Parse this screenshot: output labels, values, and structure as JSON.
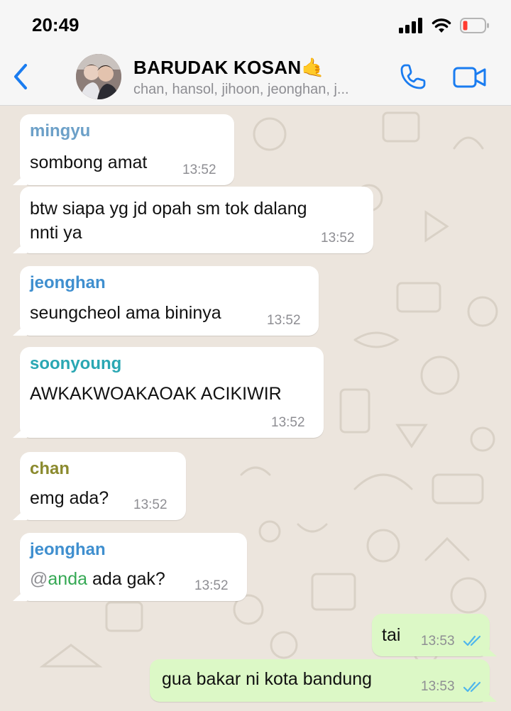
{
  "status_bar": {
    "time": "20:49"
  },
  "header": {
    "title": "BARUDAK KOSAN",
    "title_emoji": "🤙",
    "subtitle": "chan, hansol, jihoon, jeonghan, j...",
    "back_icon": "chevron-left-icon",
    "call_icon": "phone-icon",
    "video_icon": "video-camera-icon"
  },
  "colors": {
    "accent": "#1a7cf0",
    "incoming_bubble": "#ffffff",
    "outgoing_bubble": "#dcf8c6",
    "wallpaper": "#ece5dd",
    "read_ticks": "#4fb6ec"
  },
  "messages": [
    {
      "sender": "mingyu",
      "sender_color": "#6ca0c8",
      "text": "sombong amat",
      "time": "13:52"
    },
    {
      "sender": "",
      "sender_color": "",
      "text_line1": "btw siapa yg jd opah sm tok dalang",
      "text_line2": "nnti ya",
      "time": "13:52"
    },
    {
      "sender": "jeonghan",
      "sender_color": "#3f8fcf",
      "text": "seungcheol ama bininya",
      "time": "13:52"
    },
    {
      "sender": "soonyoung",
      "sender_color": "#2aa7b3",
      "text": "AWKAKWOAKAOAK ACIKIWIR",
      "time": "13:52"
    },
    {
      "sender": "chan",
      "sender_color": "#8b8a2e",
      "text": "emg ada?",
      "time": "13:52"
    },
    {
      "sender": "jeonghan",
      "sender_color": "#3f8fcf",
      "mention_at": "@",
      "mention_name": "anda",
      "text_after": " ada gak?",
      "time": "13:52"
    },
    {
      "text": "tai",
      "time": "13:53",
      "status": "read"
    },
    {
      "text": "gua bakar ni kota bandung",
      "time": "13:53",
      "status": "read"
    }
  ]
}
